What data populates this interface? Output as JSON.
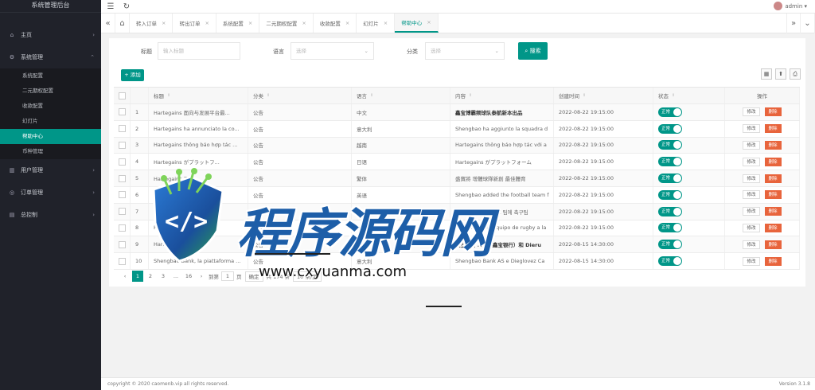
{
  "app": {
    "title": "系统管理后台"
  },
  "header": {
    "menu_icon": "☰",
    "refresh_icon": "↻",
    "user": "admin ▾"
  },
  "sidebar": {
    "groups": [
      {
        "label": "主页",
        "icon": "home-icon",
        "glyph": "⌂",
        "arrow": "›"
      },
      {
        "label": "系统管理",
        "icon": "gear-icon",
        "glyph": "⚙",
        "arrow": "⌃"
      }
    ],
    "subitems": [
      "系统配置",
      "二元期权配置",
      "收款配置",
      "幻灯片",
      "帮助中心",
      "币种管理"
    ],
    "groups2": [
      {
        "label": "用户管理",
        "glyph": "▥",
        "arrow": "›"
      },
      {
        "label": "订单管理",
        "glyph": "◎",
        "arrow": "›"
      },
      {
        "label": "总控制",
        "glyph": "▤",
        "arrow": "›"
      }
    ]
  },
  "tabs": [
    {
      "label": "转入订单",
      "close": "×"
    },
    {
      "label": "转出订单",
      "close": "×"
    },
    {
      "label": "系统配置",
      "close": "×"
    },
    {
      "label": "二元期权配置",
      "close": "×"
    },
    {
      "label": "收款配置",
      "close": "×"
    },
    {
      "label": "幻灯片",
      "close": "×"
    },
    {
      "label": "帮助中心",
      "close": "×"
    }
  ],
  "tabnav": {
    "back": "«",
    "home": "⌂",
    "forward": "»",
    "more": "⌄"
  },
  "filters": {
    "title_label": "标题",
    "title_placeholder": "输入标题",
    "lang_label": "语言",
    "lang_placeholder": "选择",
    "cat_label": "分类",
    "cat_placeholder": "选择",
    "search_label": "搜索",
    "search_icon": "⌕"
  },
  "toolbar": {
    "add_label": "+ 添加",
    "icons": [
      "▦",
      "⬆",
      "⎙"
    ]
  },
  "table": {
    "headers": [
      "标题",
      "分类",
      "语言",
      "内容",
      "创建时间",
      "状态",
      "操作"
    ],
    "sort_glyph": "⇕",
    "switch_label": "正常",
    "edit_label": "修改",
    "delete_label": "删除",
    "rows": [
      {
        "id": "1",
        "title": "Hartegains 面向与发展平台最...",
        "cat": "公告",
        "lang": "中文",
        "content": "鑫宝博霸频球队泰航新本出品",
        "bold": true,
        "time": "2022-08-22 19:15:00"
      },
      {
        "id": "2",
        "title": "Hartegains ha annunciato la co...",
        "cat": "公告",
        "lang": "意大利",
        "content": "Shengbao ha aggiunto la squadra d",
        "bold": false,
        "time": "2022-08-22 19:15:00"
      },
      {
        "id": "3",
        "title": "Hartegains thông báo hợp tác ...",
        "cat": "公告",
        "lang": "越南",
        "content": "Hartegains thông báo hợp tác với a",
        "bold": false,
        "time": "2022-08-22 19:15:00"
      },
      {
        "id": "4",
        "title": "Hartegains がプラットフ...",
        "cat": "公告",
        "lang": "日语",
        "content": "Hartegains がプラットフォーム",
        "bold": false,
        "time": "2022-08-22 19:15:00"
      },
      {
        "id": "5",
        "title": "Hartegains 平台...",
        "cat": "公告",
        "lang": "繁体",
        "content": "盛寶將 增體球隊新創 最佳體育",
        "bold": false,
        "time": "2022-08-22 19:15:00"
      },
      {
        "id": "6",
        "title": "Hartegains...",
        "cat": "公告",
        "lang": "英语",
        "content": "Shengbao added the football team f",
        "bold": false,
        "time": "2022-08-22 19:15:00"
      },
      {
        "id": "7",
        "title": "Hartegains...",
        "cat": "公告",
        "lang": "韩文",
        "content": "Saso, 허비니 스포츠 팀에 축구팀",
        "bold": false,
        "time": "2022-08-22 19:15:00"
      },
      {
        "id": "8",
        "title": "Hartegains...",
        "cat": "公告",
        "lang": "俄罗斯",
        "content": "Saso allade el equipo de rugby a la",
        "bold": false,
        "time": "2022-08-22 19:15:00"
      },
      {
        "id": "9",
        "title": "Hartegains...",
        "cat": "公告",
        "lang": "中文",
        "content": "鑫宝银行 A/S（鑫宝银行）和 Dieru",
        "bold": true,
        "time": "2022-08-15 14:30:00"
      },
      {
        "id": "10",
        "title": "Shengbao Bank, la piattaforma ...",
        "cat": "公告",
        "lang": "意大利",
        "content": "Shengbao Bank AS e Dieglovez Ca",
        "bold": false,
        "time": "2022-08-15 14:30:00"
      }
    ]
  },
  "pager": {
    "prev": "‹",
    "pages": [
      "1",
      "2",
      "3",
      "...",
      "16"
    ],
    "next": "›",
    "goto_label": "到第",
    "goto_value": "1",
    "page_unit": "页",
    "confirm": "确定",
    "total": "共 174 条",
    "per_page": "10 条/页"
  },
  "footer": {
    "left": "copyright © 2020 caomenb.vip all rights reserved.",
    "right": "Version 3.1.8"
  },
  "watermark": {
    "brand": "程序源码网",
    "url": "www.cxyuanma.com"
  }
}
